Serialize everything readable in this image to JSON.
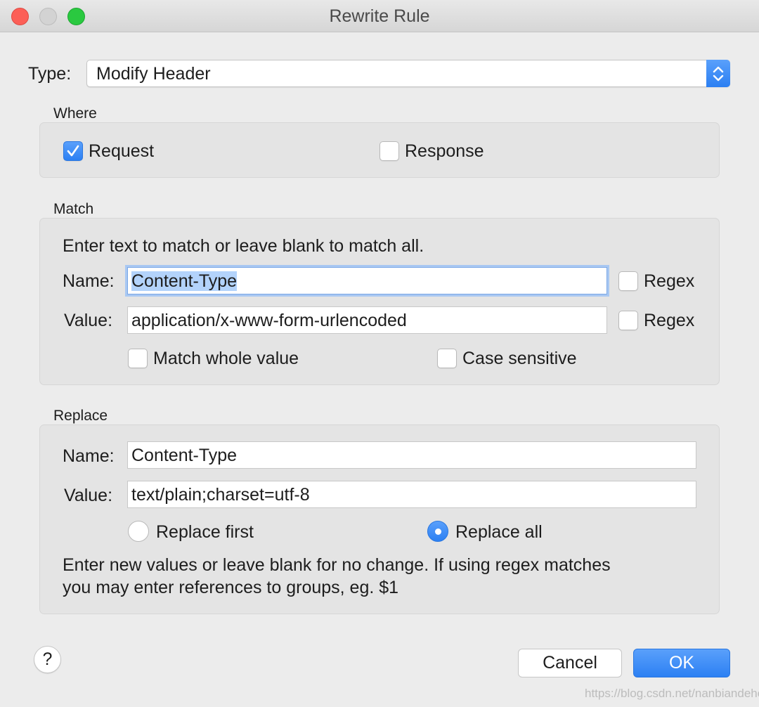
{
  "window": {
    "title": "Rewrite Rule"
  },
  "type": {
    "label": "Type:",
    "value": "Modify Header"
  },
  "where": {
    "heading": "Where",
    "request": {
      "label": "Request",
      "checked": true
    },
    "response": {
      "label": "Response",
      "checked": false
    }
  },
  "match": {
    "heading": "Match",
    "instructions": "Enter text to match or leave blank to match all.",
    "name_label": "Name:",
    "name_value": "Content-Type",
    "name_regex_label": "Regex",
    "value_label": "Value:",
    "value_value": "application/x-www-form-urlencoded",
    "value_regex_label": "Regex",
    "match_whole_label": "Match whole value",
    "case_sensitive_label": "Case sensitive"
  },
  "replace": {
    "heading": "Replace",
    "name_label": "Name:",
    "name_value": "Content-Type",
    "value_label": "Value:",
    "value_value": "text/plain;charset=utf-8",
    "replace_first_label": "Replace first",
    "replace_all_label": "Replace all",
    "selected": "Replace all",
    "help_line1": "Enter new values or leave blank for no change. If using regex matches",
    "help_line2": "you may enter references to groups, eg. $1"
  },
  "footer": {
    "help_glyph": "?",
    "cancel_label": "Cancel",
    "ok_label": "OK"
  },
  "watermark": "https://blog.csdn.net/nanbiandehe",
  "colors": {
    "accent": "#2c80f3",
    "close": "#fc5f57",
    "maximize": "#2ac940"
  }
}
